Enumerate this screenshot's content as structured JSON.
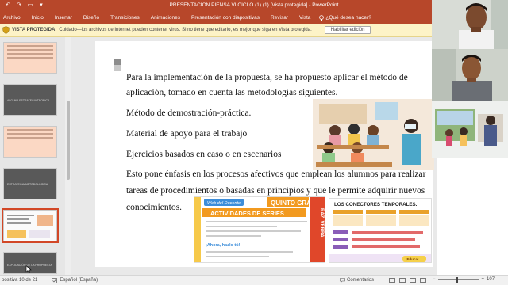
{
  "window": {
    "title": "PRESENTACIÓN PIENSA VI CICLO (1) (1) [Vista protegida] - PowerPoint"
  },
  "ribbon": {
    "tabs": [
      {
        "label": "Archivo"
      },
      {
        "label": "Inicio"
      },
      {
        "label": "Insertar"
      },
      {
        "label": "Diseño"
      },
      {
        "label": "Transiciones"
      },
      {
        "label": "Animaciones"
      },
      {
        "label": "Presentación con diapositivas"
      },
      {
        "label": "Revisar"
      },
      {
        "label": "Vista"
      }
    ],
    "tell_me": "¿Qué desea hacer?"
  },
  "protected_view": {
    "title": "VISTA PROTEGIDA",
    "message": "Cuidado—los archivos de Internet pueden contener virus. Si no tiene que editarlo, es mejor que siga en Vista protegida.",
    "enable_button": "Habilitar edición"
  },
  "thumbnails": {
    "items": [
      {
        "label": "",
        "style": "peach"
      },
      {
        "label": "ALGUNA ESTRATEGIA TEORICA",
        "style": "dark"
      },
      {
        "label": "",
        "style": "peach"
      },
      {
        "label": "ESTRATEGIA METODOLÓGICA",
        "style": "dark"
      },
      {
        "label": "",
        "style": "white"
      },
      {
        "label": "EXPLICACIÓN DE LA PROPUESTA",
        "style": "dark"
      }
    ]
  },
  "slide": {
    "paragraph1_line1": "Para la implementación de la propuesta, se ha propuesto aplicar el método de",
    "paragraph1_line2": "aplicación, tomado en cuenta las metodologías siguientes.",
    "item1": "Método de demostración-práctica.",
    "item2": "Material de apoyo para el trabajo",
    "item3": " Ejercicios basados en caso o en escenarios",
    "paragraph2_line1": "Esto pone énfasis en los procesos afectivos que emplean los alumnos para realizar",
    "paragraph2_line2": "tareas de procedimientos o basadas en principios y que le permite adquirir nuevos",
    "paragraph2_line3": "conocimientos."
  },
  "worksheet1": {
    "site": "Web del Docente",
    "grade": "QUINTO GRADO",
    "title": "ACTIVIDADES DE SERIES",
    "side_label": "RAZ. VERBAL",
    "subheading": "¡Ahora, hazlo tú!"
  },
  "worksheet2": {
    "title": "LOS CONECTORES TEMPORALES.",
    "footer": "¡Educa!"
  },
  "status_bar": {
    "slide_info": "positiva 10 de 21",
    "language": "Español (España)",
    "comments": "Comentarios",
    "zoom": "107"
  },
  "colors": {
    "accent": "#b7472a",
    "warning_bar": "#fdf3c7",
    "thumb_dark": "#595959",
    "thumb_peach": "#fbd8c4"
  }
}
